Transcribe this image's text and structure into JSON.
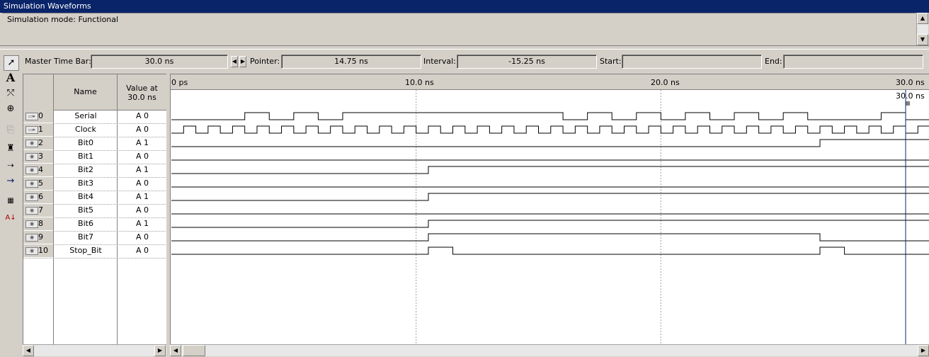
{
  "window": {
    "title": "Simulation Waveforms"
  },
  "mode": {
    "text": "Simulation mode: Functional"
  },
  "toolbar": {
    "master_label": "Master Time Bar:",
    "master_value": "30.0 ns",
    "pointer_label": "Pointer:",
    "pointer_value": "14.75 ns",
    "interval_label": "Interval:",
    "interval_value": "-15.25 ns",
    "start_label": "Start:",
    "start_value": "",
    "end_label": "End:",
    "end_value": ""
  },
  "grid": {
    "col_name": "Name",
    "col_value": "Value at\n30.0 ns",
    "rows": [
      {
        "num": "0",
        "name": "Serial",
        "value": "A 0",
        "icon": "input-pin-icon"
      },
      {
        "num": "1",
        "name": "Clock",
        "value": "A 0",
        "icon": "input-pin-icon"
      },
      {
        "num": "2",
        "name": "Bit0",
        "value": "A 1",
        "icon": "output-pin-icon"
      },
      {
        "num": "3",
        "name": "Bit1",
        "value": "A 0",
        "icon": "output-pin-icon"
      },
      {
        "num": "4",
        "name": "Bit2",
        "value": "A 1",
        "icon": "output-pin-icon"
      },
      {
        "num": "5",
        "name": "Bit3",
        "value": "A 0",
        "icon": "output-pin-icon"
      },
      {
        "num": "6",
        "name": "Bit4",
        "value": "A 1",
        "icon": "output-pin-icon"
      },
      {
        "num": "7",
        "name": "Bit5",
        "value": "A 0",
        "icon": "output-pin-icon"
      },
      {
        "num": "8",
        "name": "Bit6",
        "value": "A 1",
        "icon": "output-pin-icon"
      },
      {
        "num": "9",
        "name": "Bit7",
        "value": "A 0",
        "icon": "output-pin-icon"
      },
      {
        "num": "10",
        "name": "Stop_Bit",
        "value": "A 0",
        "icon": "output-pin-icon"
      }
    ]
  },
  "timeline": {
    "ticks": [
      "0 ps",
      "10.0 ns",
      "20.0 ns",
      "30.0 ns"
    ],
    "marker_label": "30.0 ns",
    "range_ns": [
      0,
      30.6
    ],
    "marker_ns": 30.0,
    "clock_period_ns": 1.0,
    "clock_first_rise_ns": 0.5,
    "waves": [
      {
        "name": "Serial",
        "init": 0,
        "edges": [
          3.0,
          4.0,
          5.0,
          6.0,
          7.0,
          16.0,
          17.0,
          18.0,
          19.0,
          20.0,
          21.0,
          22.0,
          23.0,
          24.0,
          25.0,
          26.0,
          29.0,
          30.0
        ]
      },
      {
        "name": "Bit0",
        "init": 0,
        "edges": [
          26.5
        ]
      },
      {
        "name": "Bit1",
        "init": 0,
        "edges": []
      },
      {
        "name": "Bit2",
        "init": 0,
        "edges": [
          10.5
        ]
      },
      {
        "name": "Bit3",
        "init": 0,
        "edges": []
      },
      {
        "name": "Bit4",
        "init": 0,
        "edges": [
          10.5
        ]
      },
      {
        "name": "Bit5",
        "init": 0,
        "edges": []
      },
      {
        "name": "Bit6",
        "init": 0,
        "edges": [
          10.5
        ]
      },
      {
        "name": "Bit7",
        "init": 0,
        "edges": [
          10.5,
          26.5
        ]
      },
      {
        "name": "Stop_Bit",
        "init": 0,
        "edges": [
          10.5,
          11.5,
          26.5,
          27.5
        ]
      }
    ]
  }
}
